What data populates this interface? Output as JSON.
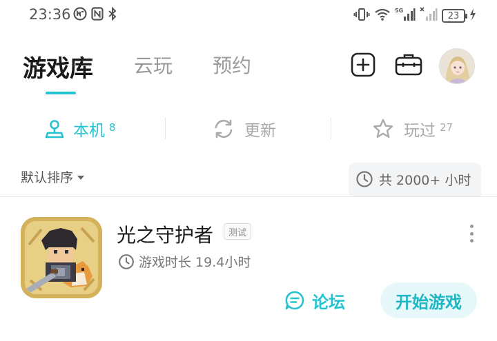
{
  "status_bar": {
    "time": "23:36",
    "battery": "23",
    "network": "5G"
  },
  "header": {
    "tabs": [
      {
        "label": "游戏库",
        "active": true
      },
      {
        "label": "云玩",
        "active": false
      },
      {
        "label": "预约",
        "active": false
      }
    ],
    "icons": [
      "add-icon",
      "toolbox-icon",
      "avatar"
    ]
  },
  "sub_tabs": [
    {
      "label": "本机",
      "count": "8",
      "icon": "local-device-icon",
      "active": true
    },
    {
      "label": "更新",
      "count": "",
      "icon": "refresh-icon",
      "active": false
    },
    {
      "label": "玩过",
      "count": "27",
      "icon": "star-icon",
      "active": false
    }
  ],
  "sort": {
    "label": "默认排序",
    "total_playtime": "共 2000+ 小时"
  },
  "games": [
    {
      "title": "光之守护者",
      "tag": "测试",
      "playtime": "游戏时长 19.4小时",
      "forum_label": "论坛",
      "play_label": "开始游戏"
    }
  ],
  "colors": {
    "accent": "#24c3cf",
    "play_button_bg": "#e6f8f9",
    "muted_text": "#aaaaaa"
  }
}
